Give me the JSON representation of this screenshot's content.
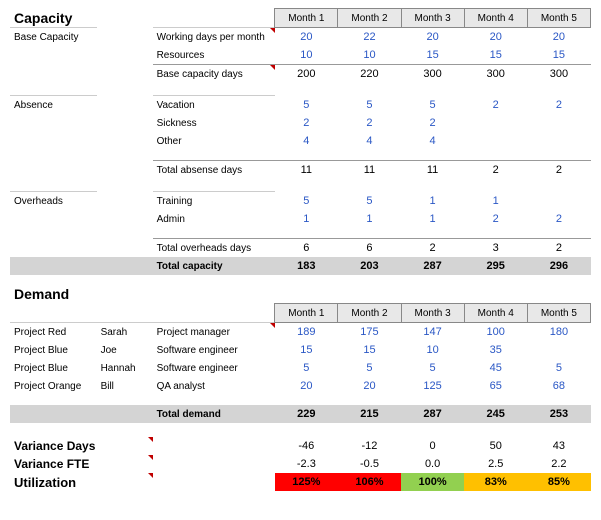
{
  "months": [
    "Month 1",
    "Month 2",
    "Month 3",
    "Month 4",
    "Month 5"
  ],
  "capacity": {
    "heading": "Capacity",
    "base": {
      "label": "Base Capacity",
      "rows": [
        {
          "label": "Working days per month",
          "vals": [
            "20",
            "22",
            "20",
            "20",
            "20"
          ]
        },
        {
          "label": "Resources",
          "vals": [
            "10",
            "10",
            "15",
            "15",
            "15"
          ]
        }
      ],
      "total": {
        "label": "Base capacity days",
        "vals": [
          "200",
          "220",
          "300",
          "300",
          "300"
        ]
      }
    },
    "absence": {
      "label": "Absence",
      "rows": [
        {
          "label": "Vacation",
          "vals": [
            "5",
            "5",
            "5",
            "2",
            "2"
          ]
        },
        {
          "label": "Sickness",
          "vals": [
            "2",
            "2",
            "2",
            "",
            ""
          ]
        },
        {
          "label": "Other",
          "vals": [
            "4",
            "4",
            "4",
            "",
            ""
          ]
        }
      ],
      "total": {
        "label": "Total absense days",
        "vals": [
          "11",
          "11",
          "11",
          "2",
          "2"
        ]
      }
    },
    "overheads": {
      "label": "Overheads",
      "rows": [
        {
          "label": "Training",
          "vals": [
            "5",
            "5",
            "1",
            "1",
            ""
          ]
        },
        {
          "label": "Admin",
          "vals": [
            "1",
            "1",
            "1",
            "2",
            "2"
          ]
        }
      ],
      "total": {
        "label": "Total overheads days",
        "vals": [
          "6",
          "6",
          "2",
          "3",
          "2"
        ]
      }
    },
    "total": {
      "label": "Total capacity",
      "vals": [
        "183",
        "203",
        "287",
        "295",
        "296"
      ]
    }
  },
  "demand": {
    "heading": "Demand",
    "rows": [
      {
        "project": "Project Red",
        "person": "Sarah",
        "role": "Project manager",
        "vals": [
          "189",
          "175",
          "147",
          "100",
          "180"
        ]
      },
      {
        "project": "Project Blue",
        "person": "Joe",
        "role": "Software engineer",
        "vals": [
          "15",
          "15",
          "10",
          "35",
          ""
        ]
      },
      {
        "project": "Project Blue",
        "person": "Hannah",
        "role": "Software engineer",
        "vals": [
          "5",
          "5",
          "5",
          "45",
          "5"
        ]
      },
      {
        "project": "Project Orange",
        "person": "Bill",
        "role": "QA analyst",
        "vals": [
          "20",
          "20",
          "125",
          "65",
          "68"
        ]
      }
    ],
    "total": {
      "label": "Total demand",
      "vals": [
        "229",
        "215",
        "287",
        "245",
        "253"
      ]
    }
  },
  "variance": {
    "days": {
      "label": "Variance Days",
      "vals": [
        "-46",
        "-12",
        "0",
        "50",
        "43"
      ]
    },
    "fte": {
      "label": "Variance FTE",
      "vals": [
        "-2.3",
        "-0.5",
        "0.0",
        "2.5",
        "2.2"
      ]
    },
    "util": {
      "label": "Utilization",
      "vals": [
        "125%",
        "106%",
        "100%",
        "83%",
        "85%"
      ],
      "classes": [
        "u-red",
        "u-red",
        "u-green",
        "u-orange",
        "u-orange"
      ]
    }
  },
  "chart_data": {
    "type": "table",
    "months": [
      "Month 1",
      "Month 2",
      "Month 3",
      "Month 4",
      "Month 5"
    ],
    "capacity": {
      "working_days": [
        20,
        22,
        20,
        20,
        20
      ],
      "resources": [
        10,
        10,
        15,
        15,
        15
      ],
      "base_capacity_days": [
        200,
        220,
        300,
        300,
        300
      ],
      "absence": {
        "vacation": [
          5,
          5,
          5,
          2,
          2
        ],
        "sickness": [
          2,
          2,
          2,
          null,
          null
        ],
        "other": [
          4,
          4,
          4,
          null,
          null
        ],
        "total": [
          11,
          11,
          11,
          2,
          2
        ]
      },
      "overheads": {
        "training": [
          5,
          5,
          1,
          1,
          null
        ],
        "admin": [
          1,
          1,
          1,
          2,
          2
        ],
        "total": [
          6,
          6,
          2,
          3,
          2
        ]
      },
      "total_capacity": [
        183,
        203,
        287,
        295,
        296
      ]
    },
    "demand": {
      "rows": [
        {
          "project": "Project Red",
          "person": "Sarah",
          "role": "Project manager",
          "values": [
            189,
            175,
            147,
            100,
            180
          ]
        },
        {
          "project": "Project Blue",
          "person": "Joe",
          "role": "Software engineer",
          "values": [
            15,
            15,
            10,
            35,
            null
          ]
        },
        {
          "project": "Project Blue",
          "person": "Hannah",
          "role": "Software engineer",
          "values": [
            5,
            5,
            5,
            45,
            5
          ]
        },
        {
          "project": "Project Orange",
          "person": "Bill",
          "role": "QA analyst",
          "values": [
            20,
            20,
            125,
            65,
            68
          ]
        }
      ],
      "total_demand": [
        229,
        215,
        287,
        245,
        253
      ]
    },
    "variance_days": [
      -46,
      -12,
      0,
      50,
      43
    ],
    "variance_fte": [
      -2.3,
      -0.5,
      0.0,
      2.5,
      2.2
    ],
    "utilization_pct": [
      125,
      106,
      100,
      83,
      85
    ]
  }
}
